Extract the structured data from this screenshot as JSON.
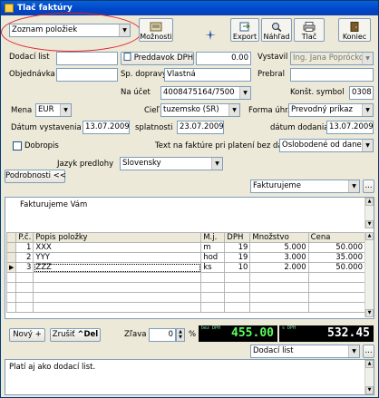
{
  "window": {
    "title": "Tlač faktúry"
  },
  "toolbar": {
    "list_combo": "Zoznam položiek",
    "moznosti": "Možnosti",
    "export": "Export",
    "nahlad": "Náhľad",
    "tlac": "Tlač",
    "koniec": "Koniec"
  },
  "header": {
    "dodaci_list_label": "Dodací list",
    "dodaci_list_value": "",
    "objednavka_label": "Objednávka",
    "objednavka_value": "",
    "preddavok_label": "Preddavok DPH",
    "preddavok_value": "0.00",
    "sp_dopravy_label": "Sp. dopravy",
    "sp_dopravy_value": "Vlastná",
    "vystavil_label": "Vystavil",
    "vystavil_value": "Ing. Jana Poprócková",
    "prebral_label": "Prebral",
    "prebral_value": "",
    "na_ucet_label": "Na účet",
    "na_ucet_value": "4008475164/7500",
    "konst_symbol_label": "Konšt. symbol",
    "konst_symbol_value": "0308",
    "mena_label": "Mena",
    "mena_value": "EUR",
    "ciel_label": "Cieľ",
    "ciel_value": "tuzemsko (SR)",
    "forma_uhr_label": "Forma úhr.",
    "forma_uhr_value": "Prevodný príkaz",
    "datum_vystavenia_label": "Dátum vystavenia",
    "datum_vystavenia_value": "13.07.2009",
    "splatnost_label": "splatnosti",
    "splatnost_value": "23.07.2009",
    "datum_dodania_label": "dátum dodania",
    "datum_dodania_value": "13.07.2009",
    "dobropis_label": "Dobropis",
    "text_platba_label": "Text na faktúre pri platení bez dane",
    "text_platba_value": "Oslobodené od dane",
    "jazyk_label": "Jazyk predlohy",
    "jazyk_value": "Slovensky",
    "podrobnosti": "Podrobnosti <<"
  },
  "panel": {
    "text_combo": "Fakturujeme",
    "ellipsis": "...",
    "intro_text": "Fakturujeme Vám",
    "columns": [
      "P.č.",
      "Popis položky",
      "M.j.",
      "DPH",
      "Množstvo",
      "Cena"
    ],
    "rows": [
      {
        "pc": "1",
        "popis": "XXX",
        "mj": "m",
        "dph": "19",
        "mnozstvo": "5.000",
        "cena": "50.000"
      },
      {
        "pc": "2",
        "popis": "YYY",
        "mj": "hod",
        "dph": "19",
        "mnozstvo": "3.000",
        "cena": "35.000"
      },
      {
        "pc": "3",
        "popis": "ZZZ",
        "mj": "ks",
        "dph": "10",
        "mnozstvo": "2.000",
        "cena": "50.000"
      }
    ]
  },
  "footer": {
    "novy": "Nový",
    "novy_key": "+",
    "zrusit": "Zrušiť",
    "zrusit_key": "^Del",
    "zlava_label": "Zľava",
    "zlava_value": "0",
    "percent": "%",
    "total_bez_dph_caption": "bez DPH",
    "total_bez_dph": "455.00",
    "total_s_dph_caption": "s DPH",
    "total_s_dph": "532.45",
    "note_combo": "Dodací list",
    "note_text": "Platí aj ako dodací list."
  },
  "colors": {
    "title_bar": "#0046c8",
    "lcd_text": "#5dff5d",
    "highlight_oval": "#e0242c"
  }
}
